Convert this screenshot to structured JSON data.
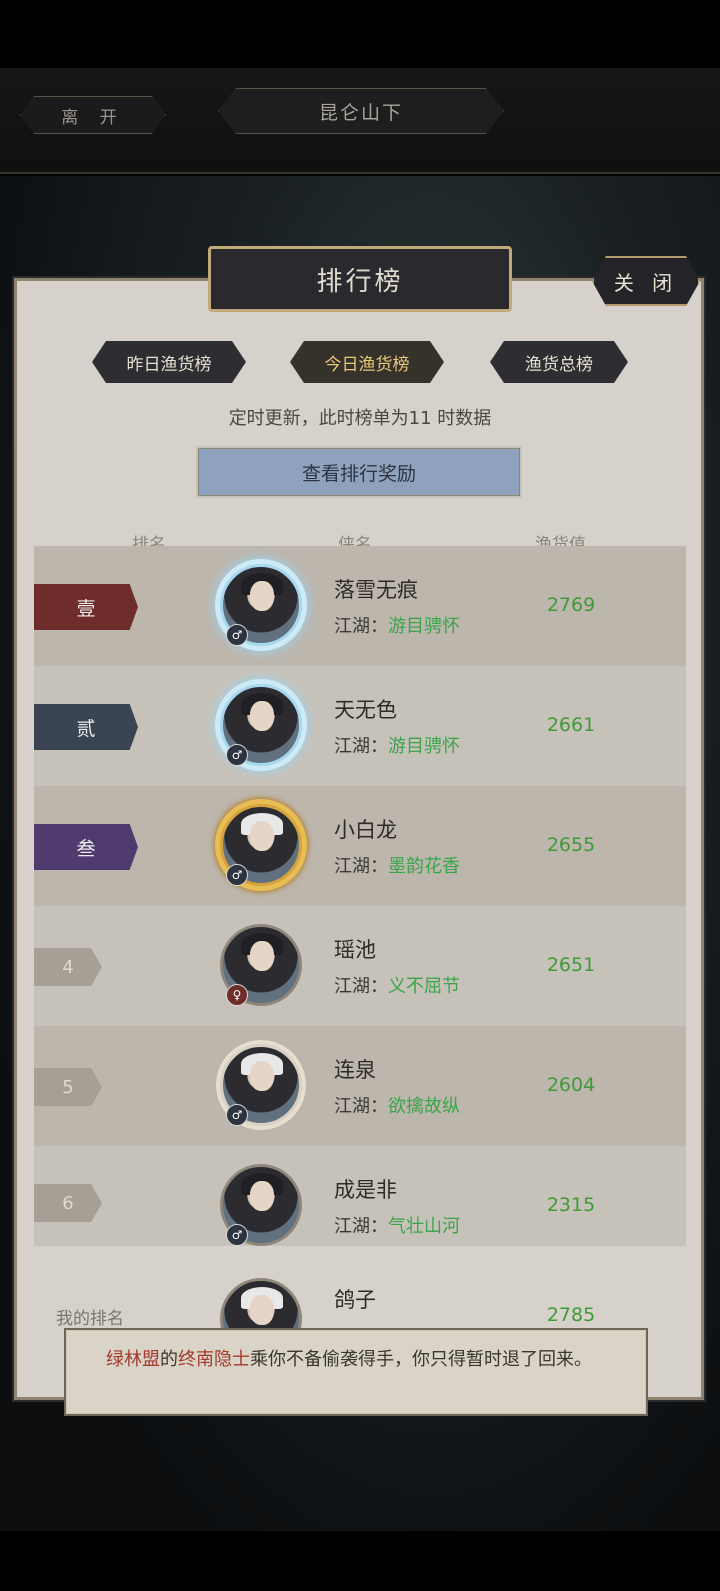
{
  "top": {
    "leave_label": "离 开",
    "location": "昆仑山下"
  },
  "panel": {
    "title": "排行榜",
    "close_label": "关 闭"
  },
  "tabs": [
    {
      "label": "昨日渔货榜",
      "active": false
    },
    {
      "label": "今日渔货榜",
      "active": true
    },
    {
      "label": "渔货总榜",
      "active": false
    }
  ],
  "update_note": "定时更新，此时榜单为11 时数据",
  "reward_button": "查看排行奖励",
  "columns": {
    "rank": "排名",
    "name": "侠名",
    "score": "渔货值"
  },
  "sect_prefix": "江湖：",
  "rows": [
    {
      "rank": "壹",
      "name": "落雪无痕",
      "sect": "游目骋怀",
      "score": "2769",
      "gender": "♂",
      "rank_color": "#6e2d2a",
      "frame": "ice"
    },
    {
      "rank": "贰",
      "name": "天无色",
      "sect": "游目骋怀",
      "score": "2661",
      "gender": "♂",
      "rank_color": "#3b4452",
      "frame": "ice"
    },
    {
      "rank": "叁",
      "name": "小白龙",
      "sect": "墨韵花香",
      "score": "2655",
      "gender": "♂",
      "rank_color": "#4f3b6e",
      "frame": "gold"
    },
    {
      "rank": "4",
      "name": "瑶池",
      "sect": "义不屈节",
      "score": "2651",
      "gender": "♀",
      "frame": "plain"
    },
    {
      "rank": "5",
      "name": "连泉",
      "sect": "欲擒故纵",
      "score": "2604",
      "gender": "♂",
      "frame": "silver"
    },
    {
      "rank": "6",
      "name": "成是非",
      "sect": "气壮山河",
      "score": "2315",
      "gender": "♂",
      "frame": "plain"
    }
  ],
  "my_rank": {
    "label": "我的排名",
    "name": "鸽子",
    "score": "2785"
  },
  "toast": {
    "part1": "绿林盟",
    "part2": "的",
    "part3": "终南隐士",
    "part4": "乘你不备偷袭得手，你只得暂时退了回来。"
  }
}
